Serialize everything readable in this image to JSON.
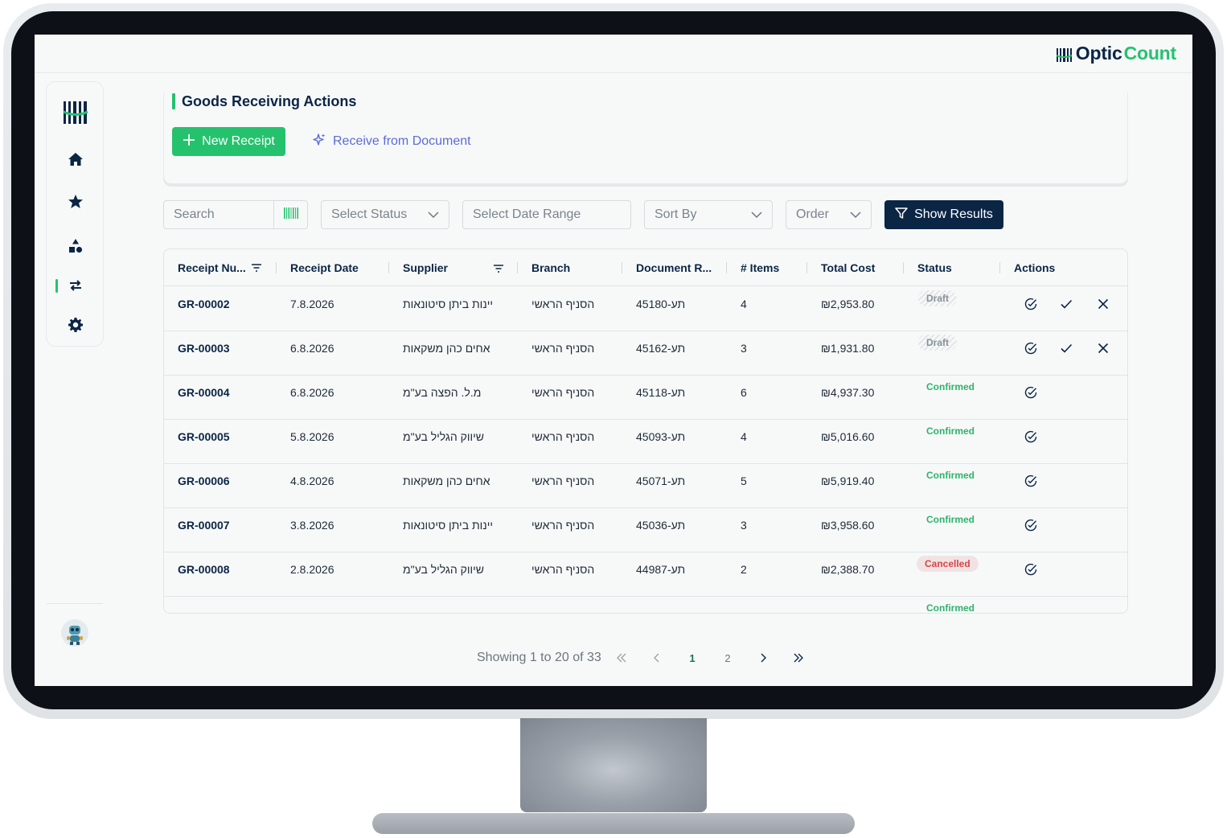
{
  "app": {
    "logo_part1": "Optic",
    "logo_part2": "Count",
    "brand_colors": {
      "navy": "#0b2545",
      "green": "#25c26e",
      "accent_blue": "#5c6bd6"
    }
  },
  "sidebar": {
    "items": [
      {
        "icon": "barcode-logo-icon"
      },
      {
        "icon": "home-icon"
      },
      {
        "icon": "star-icon"
      },
      {
        "icon": "shapes-icon"
      },
      {
        "icon": "transfer-arrows-icon",
        "active": true
      },
      {
        "icon": "gear-icon"
      }
    ],
    "avatar_icon": "robot-avatar"
  },
  "actions": {
    "title": "Goods Receiving Actions",
    "new_receipt": "New Receipt",
    "receive_from_document": "Receive from Document"
  },
  "filters": {
    "search_placeholder": "Search",
    "status_placeholder": "Select Status",
    "date_placeholder": "Select Date Range",
    "sort_placeholder": "Sort By",
    "order_placeholder": "Order",
    "show_results": "Show Results"
  },
  "table": {
    "headers": [
      "Receipt Nu...",
      "Receipt Date",
      "Supplier",
      "Branch",
      "Document R...",
      "# Items",
      "Total Cost",
      "Status",
      "Actions"
    ],
    "rows": [
      {
        "id": "GR-00002",
        "date": "7.8.2026",
        "supplier": "יינות ביתן סיטונאות",
        "branch": "הסניף הראשי",
        "doc": "תע-45180",
        "items": "4",
        "total": "₪2,953.80",
        "status": "Draft",
        "status_kind": "draft"
      },
      {
        "id": "GR-00003",
        "date": "6.8.2026",
        "supplier": "אחים כהן משקאות",
        "branch": "הסניף הראשי",
        "doc": "תע-45162",
        "items": "3",
        "total": "₪1,931.80",
        "status": "Draft",
        "status_kind": "draft"
      },
      {
        "id": "GR-00004",
        "date": "6.8.2026",
        "supplier": "מ.ל. הפצה בע\"מ",
        "branch": "הסניף הראשי",
        "doc": "תע-45118",
        "items": "6",
        "total": "₪4,937.30",
        "status": "Confirmed",
        "status_kind": "confirmed"
      },
      {
        "id": "GR-00005",
        "date": "5.8.2026",
        "supplier": "שיווק הגליל בע\"מ",
        "branch": "הסניף הראשי",
        "doc": "תע-45093",
        "items": "4",
        "total": "₪5,016.60",
        "status": "Confirmed",
        "status_kind": "confirmed"
      },
      {
        "id": "GR-00006",
        "date": "4.8.2026",
        "supplier": "אחים כהן משקאות",
        "branch": "הסניף הראשי",
        "doc": "תע-45071",
        "items": "5",
        "total": "₪5,919.40",
        "status": "Confirmed",
        "status_kind": "confirmed"
      },
      {
        "id": "GR-00007",
        "date": "3.8.2026",
        "supplier": "יינות ביתן סיטונאות",
        "branch": "הסניף הראשי",
        "doc": "תע-45036",
        "items": "3",
        "total": "₪3,958.60",
        "status": "Confirmed",
        "status_kind": "confirmed"
      },
      {
        "id": "GR-00008",
        "date": "2.8.2026",
        "supplier": "שיווק הגליל בע\"מ",
        "branch": "הסניף הראשי",
        "doc": "תע-44987",
        "items": "2",
        "total": "₪2,388.70",
        "status": "Cancelled",
        "status_kind": "cancelled"
      },
      {
        "id": "",
        "date": "",
        "supplier": "",
        "branch": "",
        "doc": "",
        "items": "",
        "total": "",
        "status": "Confirmed",
        "status_kind": "confirmed"
      }
    ]
  },
  "pagination": {
    "summary": "Showing 1 to 20 of 33",
    "pages": [
      "1",
      "2"
    ],
    "current": "1"
  }
}
